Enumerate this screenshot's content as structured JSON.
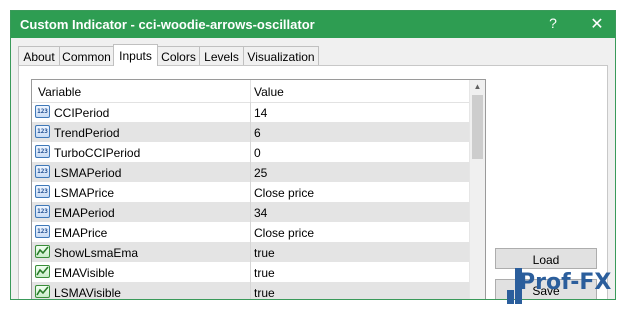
{
  "window": {
    "title": "Custom Indicator - cci-woodie-arrows-oscillator",
    "help": "?",
    "close": "✕"
  },
  "tabs": [
    {
      "label": "About"
    },
    {
      "label": "Common"
    },
    {
      "label": "Inputs"
    },
    {
      "label": "Colors"
    },
    {
      "label": "Levels"
    },
    {
      "label": "Visualization"
    }
  ],
  "active_tab": "Inputs",
  "grid": {
    "col_variable": "Variable",
    "col_value": "Value",
    "rows": [
      {
        "icon": "number-icon",
        "icon_text": "123",
        "variable": "CCIPeriod",
        "value": "14"
      },
      {
        "icon": "number-icon",
        "icon_text": "123",
        "variable": "TrendPeriod",
        "value": "6"
      },
      {
        "icon": "number-icon",
        "icon_text": "123",
        "variable": "TurboCCIPeriod",
        "value": "0"
      },
      {
        "icon": "number-icon",
        "icon_text": "123",
        "variable": "LSMAPeriod",
        "value": "25"
      },
      {
        "icon": "number-icon",
        "icon_text": "123",
        "variable": "LSMAPrice",
        "value": "Close price"
      },
      {
        "icon": "number-icon",
        "icon_text": "123",
        "variable": "EMAPeriod",
        "value": "34"
      },
      {
        "icon": "number-icon",
        "icon_text": "123",
        "variable": "EMAPrice",
        "value": "Close price"
      },
      {
        "icon": "boolean-icon",
        "icon_text": "",
        "variable": "ShowLsmaEma",
        "value": "true"
      },
      {
        "icon": "boolean-icon",
        "icon_text": "",
        "variable": "EMAVisible",
        "value": "true"
      },
      {
        "icon": "boolean-icon",
        "icon_text": "",
        "variable": "LSMAVisible",
        "value": "true"
      }
    ]
  },
  "buttons": {
    "load": "Load",
    "save": "Save"
  },
  "watermark": {
    "text": "Prof-FX"
  },
  "colors": {
    "titlebar": "#2e9d52",
    "alt_row": "#e4e4e4",
    "watermark": "#2b5e9c"
  }
}
